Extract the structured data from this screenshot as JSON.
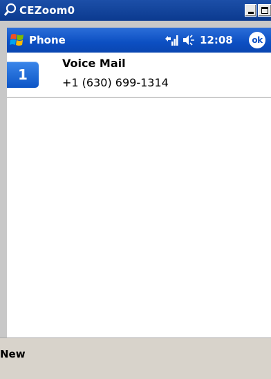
{
  "host_window": {
    "title": "CEZoom0",
    "icon": "magnifier-icon"
  },
  "navbar": {
    "title": "Phone",
    "time": "12:08",
    "ok_label": "ok",
    "icons": [
      "start-flag-icon",
      "signal-icon",
      "volume-icon"
    ]
  },
  "speed_dial": {
    "items": [
      {
        "slot": "1",
        "name": "Voice Mail",
        "number": "+1 (630) 699-1314"
      }
    ]
  },
  "softkeys": {
    "left": "New"
  },
  "colors": {
    "navbar_blue": "#0c4fc2",
    "badge_blue": "#1a66d8",
    "softbar_bg": "#d8d3cb",
    "frame_gray": "#c8c8c8"
  }
}
